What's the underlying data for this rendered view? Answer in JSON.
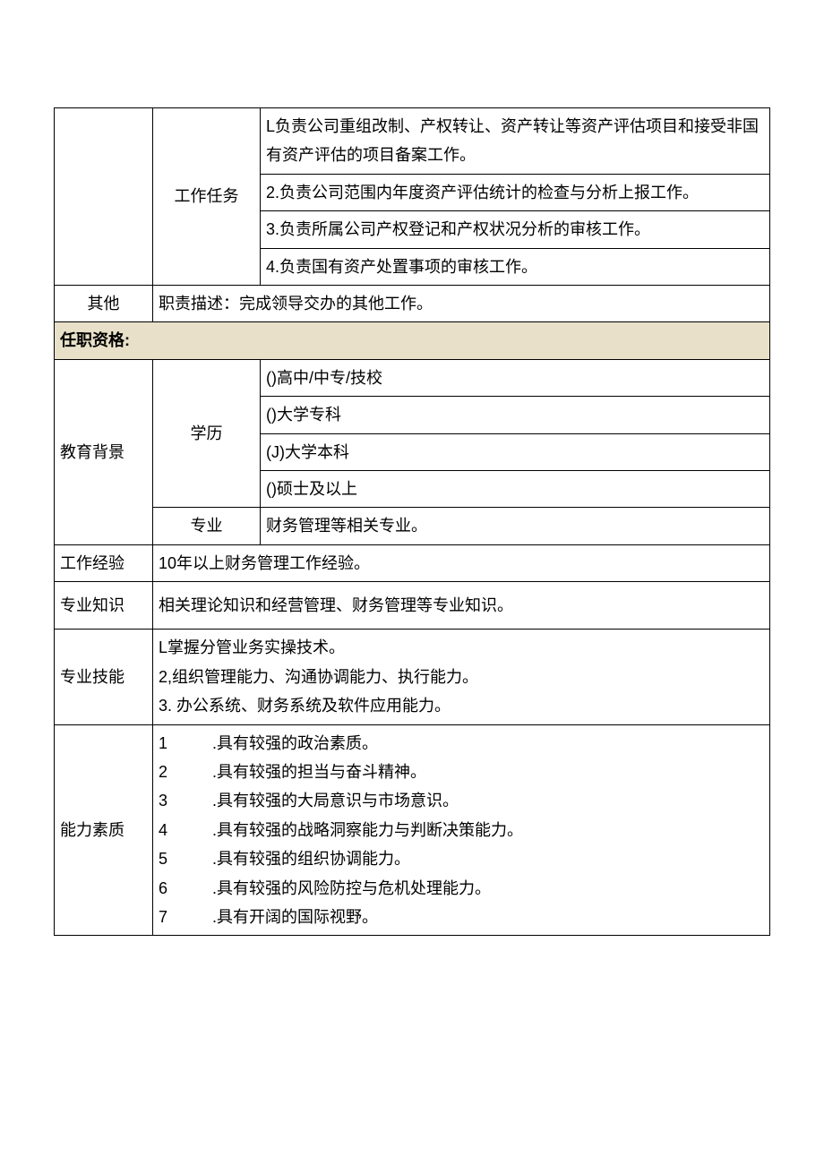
{
  "tasks": {
    "label": "工作任务",
    "items": [
      "L负责公司重组改制、产权转让、资产转让等资产评估项目和接受非国有资产评估的项目备案工作。",
      "2.负责公司范围内年度资产评估统计的检查与分析上报工作。",
      "3.负责所属公司产权登记和产权状况分析的审核工作。",
      "4.负责国有资产处置事项的审核工作。"
    ]
  },
  "other": {
    "label": "其他",
    "text": "职责描述：完成领导交办的其他工作。"
  },
  "section_header": "任职资格:",
  "education": {
    "label": "教育背景",
    "degree_label": "学历",
    "degrees": [
      "()高中/中专/技校",
      "()大学专科",
      "(J)大学本科",
      "()硕士及以上"
    ],
    "major_label": "专业",
    "major": "财务管理等相关专业。"
  },
  "experience": {
    "label": "工作经验",
    "text": "10年以上财务管理工作经验。"
  },
  "knowledge": {
    "label": "专业知识",
    "text": "相关理论知识和经营管理、财务管理等专业知识。"
  },
  "skills": {
    "label": "专业技能",
    "items": [
      "L掌握分管业务实操技术。",
      "2,组织管理能力、沟通协调能力、执行能力。",
      "3. 办公系统、财务系统及软件应用能力。"
    ]
  },
  "abilities": {
    "label": "能力素质",
    "items": [
      {
        "n": "1",
        "t": ".具有较强的政治素质。"
      },
      {
        "n": "2",
        "t": ".具有较强的担当与奋斗精神。"
      },
      {
        "n": "3",
        "t": ".具有较强的大局意识与市场意识。"
      },
      {
        "n": "4",
        "t": ".具有较强的战略洞察能力与判断决策能力。"
      },
      {
        "n": "5",
        "t": ".具有较强的组织协调能力。"
      },
      {
        "n": "6",
        "t": ".具有较强的风险防控与危机处理能力。"
      },
      {
        "n": "7",
        "t": ".具有开阔的国际视野。"
      }
    ]
  }
}
